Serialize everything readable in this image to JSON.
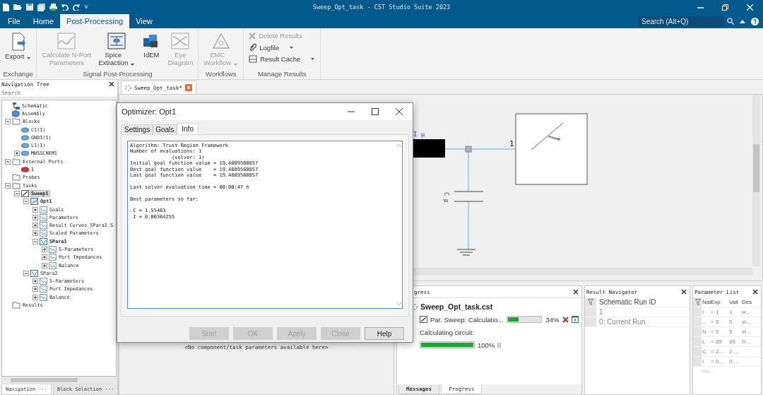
{
  "window": {
    "title": "Sweep_Opt_task - CST Studio Suite 2023"
  },
  "menu_tabs": [
    {
      "label": "File",
      "selected": false
    },
    {
      "label": "Home",
      "selected": false
    },
    {
      "label": "Post-Processing",
      "selected": true
    },
    {
      "label": "View",
      "selected": false
    }
  ],
  "search": {
    "placeholder": "Search (Alt+Q)"
  },
  "ribbon": {
    "groups": [
      {
        "label": "Exchange",
        "kind": "large",
        "buttons": [
          {
            "label": "Export",
            "kind": "export",
            "menu": true,
            "disabled": false
          }
        ]
      },
      {
        "label": "Signal Post-Processing",
        "kind": "large",
        "buttons": [
          {
            "label": "Calculate N-Port\nParameters",
            "kind": "nport",
            "menu": false,
            "disabled": true
          },
          {
            "label": "Spice\nExtraction",
            "kind": "spice",
            "menu": true,
            "disabled": false
          },
          {
            "label": "IdEM",
            "kind": "idem",
            "menu": false,
            "disabled": false
          },
          {
            "label": "Eye\nDiagram",
            "kind": "eye",
            "menu": false,
            "disabled": true
          }
        ]
      },
      {
        "label": "Workflows",
        "kind": "large",
        "buttons": [
          {
            "label": "EMC\nWorkflow",
            "kind": "emc",
            "menu": true,
            "disabled": true
          }
        ]
      },
      {
        "label": "Manage Results",
        "kind": "small",
        "buttons": [
          {
            "label": "Delete Results",
            "kind": "delete",
            "menu": false,
            "disabled": true
          },
          {
            "label": "Logfile",
            "kind": "clip",
            "menu": true,
            "disabled": false
          },
          {
            "label": "Result Cache",
            "kind": "drive",
            "menu": true,
            "disabled": false
          }
        ]
      }
    ]
  },
  "nav": {
    "title": "Navigation Tree",
    "search_placeholder": "Search",
    "items": [
      {
        "label": "Schematic",
        "kind": "schematic",
        "selected": false
      },
      {
        "label": "Assembly",
        "kind": "assembly",
        "selected": false
      },
      {
        "label": "Blocks",
        "kind": "folder",
        "selected": false,
        "expanded": true,
        "children": [
          {
            "label": "C1(1)",
            "kind": "block",
            "selected": false
          },
          {
            "label": "GND1(1)",
            "kind": "block",
            "selected": false
          },
          {
            "label": "L1(1)",
            "kind": "block",
            "selected": false
          },
          {
            "label": "MWSSCHEM1",
            "kind": "block",
            "selected": false,
            "expanded": false
          }
        ]
      },
      {
        "label": "External Ports",
        "kind": "folder",
        "selected": false,
        "expanded": true,
        "children": [
          {
            "label": "1",
            "kind": "port",
            "selected": false
          }
        ]
      },
      {
        "label": "Probes",
        "kind": "folder",
        "selected": false
      },
      {
        "label": "Tasks",
        "kind": "folder",
        "selected": false,
        "expanded": true,
        "children": [
          {
            "label": "Sweep1",
            "kind": "sweep",
            "selected": true,
            "bold": true,
            "expanded": true,
            "children": [
              {
                "label": "Opt1",
                "kind": "optimizer",
                "selected": false,
                "bold": true,
                "expanded": true,
                "children": [
                  {
                    "label": "Goals",
                    "kind": "result",
                    "selected": false,
                    "expanded": false
                  },
                  {
                    "label": "Parameters",
                    "kind": "result",
                    "selected": false,
                    "expanded": false
                  },
                  {
                    "label": "Result Curves_SPara1_S",
                    "kind": "result",
                    "selected": false,
                    "expanded": false
                  },
                  {
                    "label": "Scaled Parameters",
                    "kind": "result",
                    "selected": false,
                    "expanded": false
                  },
                  {
                    "label": "SPara1",
                    "kind": "sparam",
                    "selected": false,
                    "bold": true,
                    "expanded": true,
                    "children": [
                      {
                        "label": "S-Parameters",
                        "kind": "result",
                        "selected": false,
                        "expanded": false
                      },
                      {
                        "label": "Port Impedances",
                        "kind": "result",
                        "selected": false,
                        "expanded": false
                      },
                      {
                        "label": "Balance",
                        "kind": "result",
                        "selected": false,
                        "expanded": false
                      }
                    ]
                  }
                ]
              },
              {
                "label": "SPara2",
                "kind": "sparam",
                "selected": false,
                "expanded": true,
                "children": [
                  {
                    "label": "S-Parameters",
                    "kind": "result",
                    "selected": false,
                    "expanded": false
                  },
                  {
                    "label": "Port Impedances",
                    "kind": "result",
                    "selected": false,
                    "expanded": false
                  },
                  {
                    "label": "Balance",
                    "kind": "result",
                    "selected": false,
                    "expanded": false
                  }
                ]
              }
            ]
          }
        ]
      },
      {
        "label": "Results",
        "kind": "folder",
        "selected": false
      }
    ],
    "tabs": [
      {
        "label": "Navigation ···",
        "selected": true
      },
      {
        "label": "Block Selection ···",
        "selected": false
      }
    ]
  },
  "document_tabs": [
    {
      "label": "Sweep_Opt_task*",
      "selected": true
    }
  ],
  "schematic": {
    "inductor_label": "I μ",
    "capacitor_label": "C p",
    "port_label": "1"
  },
  "parameter_panel": {
    "message": "<No component/task parameters available here>"
  },
  "progress": {
    "title": "gress",
    "project": "Sweep_Opt_task.cst",
    "task": {
      "label": "Par. Sweep: Calculatio...",
      "level": 0.34,
      "percent": "34%"
    },
    "step": {
      "label": "Calculating circuit:",
      "level": 1,
      "percent": "100%"
    },
    "tabs": [
      {
        "label": "Messages",
        "selected": false
      },
      {
        "label": "Progress",
        "selected": true
      }
    ]
  },
  "result_navigator": {
    "title": "Result Navigator",
    "column": "Schematic Run ID",
    "rows": [
      "1",
      "0: Current Run"
    ]
  },
  "parameter_list": {
    "title": "Parameter List",
    "columns": [
      "Nar",
      "Exp",
      "Vali",
      "Des"
    ],
    "rows": [
      {
        "name": "r",
        "expression": "= 1",
        "value": "1",
        "description": "w..."
      },
      {
        "name": "...",
        "expression": "= 5",
        "value": "5",
        "description": "st..."
      },
      {
        "name": "N",
        "expression": "= 5",
        "value": "5",
        "description": "st..."
      },
      {
        "name": "L",
        "expression": "= 85",
        "value": "85",
        "description": "D..."
      },
      {
        "name": "C",
        "expression": "= 2....",
        "value": "2...."
      },
      {
        "name": "I",
        "expression": "= 0....",
        "value": "0...."
      }
    ],
    "new_row": "<n..."
  },
  "optimizer": {
    "title": "Optimizer: Opt1",
    "tabs": [
      {
        "label": "Settings",
        "selected": false
      },
      {
        "label": "Goals",
        "selected": false
      },
      {
        "label": "Info",
        "selected": true
      }
    ],
    "info_text": "Algorithm: Trust Region Framework\nNumber of evaluations: 1\n              (solver: 1)\nInitial goal function value = 19.4889560857\nBest goal function value    = 19.4889560857\nLast goal function value    = 19.4889560857\n\nLast solver evaluation time = 00:00:47 h\n\nBest parameters so far:\n\n C = 1.55463\n I = 0.00364255",
    "buttons": [
      {
        "label": "Start",
        "disabled": true
      },
      {
        "label": "OK",
        "disabled": true
      },
      {
        "label": "Apply",
        "disabled": true
      },
      {
        "label": "Close",
        "disabled": true
      },
      {
        "label": "Help",
        "disabled": false
      }
    ]
  }
}
